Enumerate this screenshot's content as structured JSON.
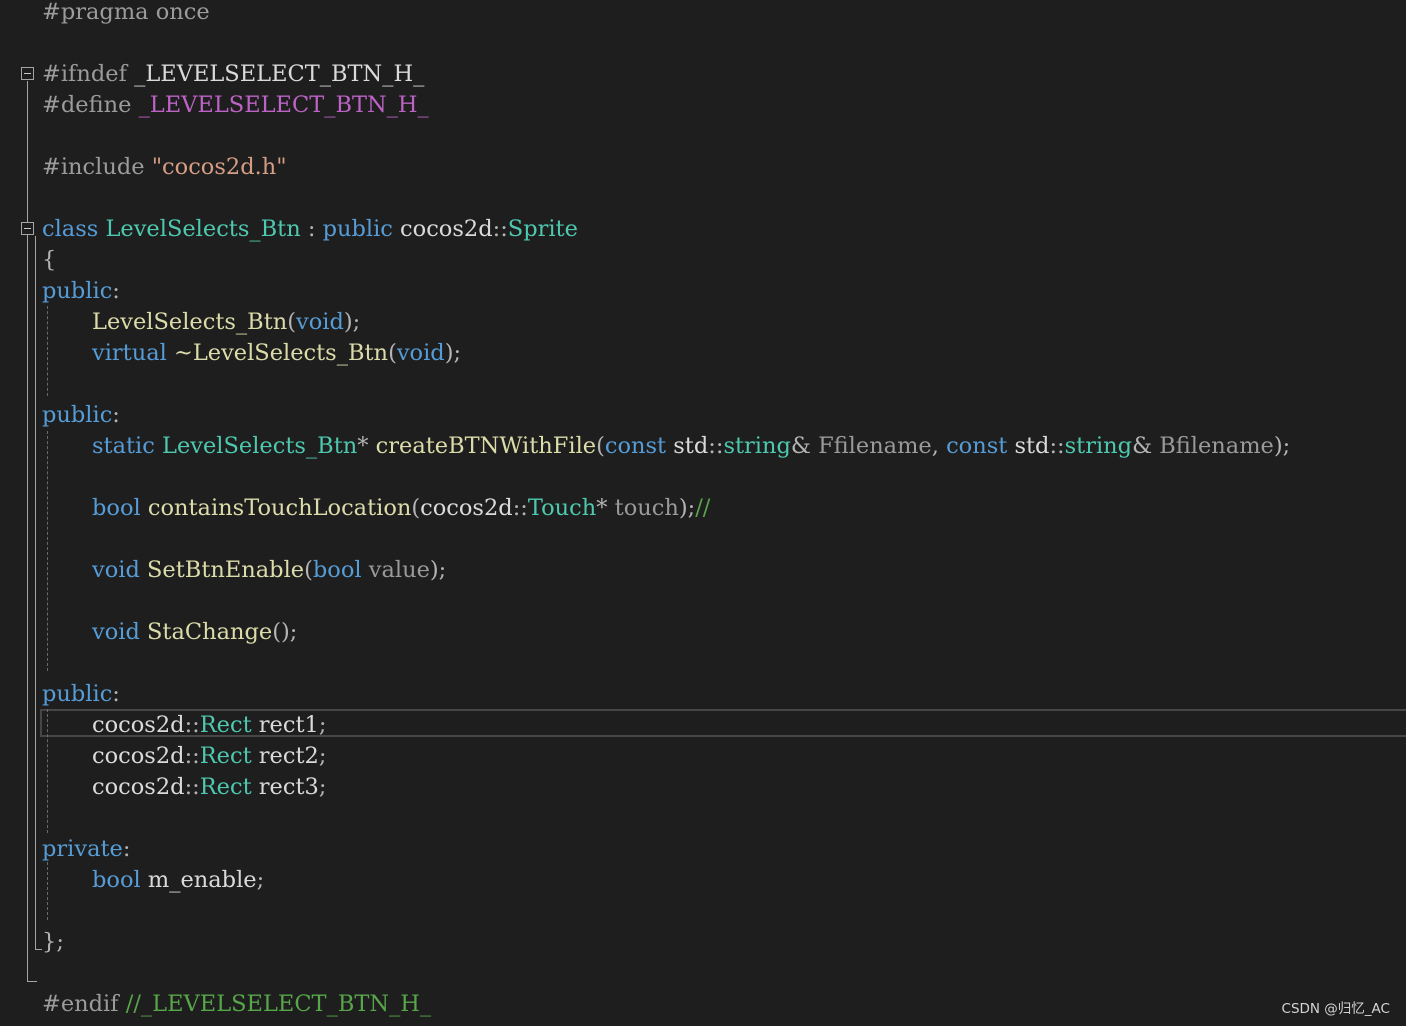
{
  "editor": {
    "language": "cpp",
    "theme_colors": {
      "background": "#1e1e1e",
      "preprocessor": "#9b9b9b",
      "keyword": "#569cd6",
      "type": "#4ec9b0",
      "function": "#dcdcaa",
      "string": "#d69d85",
      "comment": "#57a64a",
      "punctuation": "#b4b4b4",
      "identifier": "#dadada",
      "parameter": "#9a9a9a",
      "macro": "#bd63c5"
    },
    "current_line": 23,
    "fold_markers": [
      "ifndef-region",
      "class-region"
    ],
    "lines": [
      {
        "n": 1,
        "tokens": [
          {
            "t": "#pragma once",
            "c": "pp"
          }
        ]
      },
      {
        "n": 3,
        "tokens": [
          {
            "t": "#ifndef ",
            "c": "pp"
          },
          {
            "t": "_LEVELSELECT_BTN_H_",
            "c": "id"
          }
        ]
      },
      {
        "n": 4,
        "tokens": [
          {
            "t": "#define ",
            "c": "pp"
          },
          {
            "t": "_LEVELSELECT_BTN_H_",
            "c": "mac"
          }
        ]
      },
      {
        "n": 6,
        "tokens": [
          {
            "t": "#include ",
            "c": "pp"
          },
          {
            "t": "\"cocos2d.h\"",
            "c": "str"
          }
        ]
      },
      {
        "n": 8,
        "tokens": [
          {
            "t": "class",
            "c": "kw"
          },
          {
            "t": " ",
            "c": "id"
          },
          {
            "t": "LevelSelects_Btn",
            "c": "type"
          },
          {
            "t": " : ",
            "c": "pu"
          },
          {
            "t": "public",
            "c": "kw"
          },
          {
            "t": " cocos2d",
            "c": "id"
          },
          {
            "t": "::",
            "c": "pu"
          },
          {
            "t": "Sprite",
            "c": "type"
          }
        ]
      },
      {
        "n": 9,
        "tokens": [
          {
            "t": "{",
            "c": "pu"
          }
        ]
      },
      {
        "n": 10,
        "tokens": [
          {
            "t": "public",
            "c": "kw"
          },
          {
            "t": ":",
            "c": "pu"
          }
        ]
      },
      {
        "n": 11,
        "indent": true,
        "tokens": [
          {
            "t": "LevelSelects_Btn",
            "c": "fn"
          },
          {
            "t": "(",
            "c": "pu"
          },
          {
            "t": "void",
            "c": "kw"
          },
          {
            "t": ");",
            "c": "pu"
          }
        ]
      },
      {
        "n": 12,
        "indent": true,
        "tokens": [
          {
            "t": "virtual",
            "c": "kw"
          },
          {
            "t": " ",
            "c": "id"
          },
          {
            "t": "~LevelSelects_Btn",
            "c": "fn"
          },
          {
            "t": "(",
            "c": "pu"
          },
          {
            "t": "void",
            "c": "kw"
          },
          {
            "t": ");",
            "c": "pu"
          }
        ]
      },
      {
        "n": 14,
        "tokens": [
          {
            "t": "public",
            "c": "kw"
          },
          {
            "t": ":",
            "c": "pu"
          }
        ]
      },
      {
        "n": 15,
        "indent": true,
        "tokens": [
          {
            "t": "static",
            "c": "kw"
          },
          {
            "t": " ",
            "c": "id"
          },
          {
            "t": "LevelSelects_Btn",
            "c": "type"
          },
          {
            "t": "* ",
            "c": "pu"
          },
          {
            "t": "createBTNWithFile",
            "c": "fn"
          },
          {
            "t": "(",
            "c": "pu"
          },
          {
            "t": "const",
            "c": "kw"
          },
          {
            "t": " std",
            "c": "id"
          },
          {
            "t": "::",
            "c": "pu"
          },
          {
            "t": "string",
            "c": "type"
          },
          {
            "t": "& ",
            "c": "pu"
          },
          {
            "t": "Ffilename",
            "c": "par"
          },
          {
            "t": ", ",
            "c": "pu"
          },
          {
            "t": "const",
            "c": "kw"
          },
          {
            "t": " std",
            "c": "id"
          },
          {
            "t": "::",
            "c": "pu"
          },
          {
            "t": "string",
            "c": "type"
          },
          {
            "t": "& ",
            "c": "pu"
          },
          {
            "t": "Bfilename",
            "c": "par"
          },
          {
            "t": ");",
            "c": "pu"
          }
        ]
      },
      {
        "n": 17,
        "indent": true,
        "tokens": [
          {
            "t": "bool",
            "c": "kw"
          },
          {
            "t": " ",
            "c": "id"
          },
          {
            "t": "containsTouchLocation",
            "c": "fn"
          },
          {
            "t": "(",
            "c": "pu"
          },
          {
            "t": "cocos2d",
            "c": "id"
          },
          {
            "t": "::",
            "c": "pu"
          },
          {
            "t": "Touch",
            "c": "type"
          },
          {
            "t": "* ",
            "c": "pu"
          },
          {
            "t": "touch",
            "c": "par"
          },
          {
            "t": ");",
            "c": "pu"
          },
          {
            "t": "//",
            "c": "cm"
          }
        ]
      },
      {
        "n": 19,
        "indent": true,
        "tokens": [
          {
            "t": "void",
            "c": "kw"
          },
          {
            "t": " ",
            "c": "id"
          },
          {
            "t": "SetBtnEnable",
            "c": "fn"
          },
          {
            "t": "(",
            "c": "pu"
          },
          {
            "t": "bool",
            "c": "kw"
          },
          {
            "t": " ",
            "c": "id"
          },
          {
            "t": "value",
            "c": "par"
          },
          {
            "t": ");",
            "c": "pu"
          }
        ]
      },
      {
        "n": 21,
        "indent": true,
        "tokens": [
          {
            "t": "void",
            "c": "kw"
          },
          {
            "t": " ",
            "c": "id"
          },
          {
            "t": "StaChange",
            "c": "fn"
          },
          {
            "t": "();",
            "c": "pu"
          }
        ]
      },
      {
        "n": 23,
        "tokens": [
          {
            "t": "public",
            "c": "kw"
          },
          {
            "t": ":",
            "c": "pu"
          }
        ]
      },
      {
        "n": 24,
        "indent": true,
        "tokens": [
          {
            "t": "cocos2d",
            "c": "id"
          },
          {
            "t": "::",
            "c": "pu"
          },
          {
            "t": "Rect",
            "c": "type"
          },
          {
            "t": " rect1",
            "c": "id"
          },
          {
            "t": ";",
            "c": "pu"
          }
        ]
      },
      {
        "n": 25,
        "indent": true,
        "tokens": [
          {
            "t": "cocos2d",
            "c": "id"
          },
          {
            "t": "::",
            "c": "pu"
          },
          {
            "t": "Rect",
            "c": "type"
          },
          {
            "t": " rect2",
            "c": "id"
          },
          {
            "t": ";",
            "c": "pu"
          }
        ]
      },
      {
        "n": 26,
        "indent": true,
        "tokens": [
          {
            "t": "cocos2d",
            "c": "id"
          },
          {
            "t": "::",
            "c": "pu"
          },
          {
            "t": "Rect",
            "c": "type"
          },
          {
            "t": " rect3",
            "c": "id"
          },
          {
            "t": ";",
            "c": "pu"
          }
        ]
      },
      {
        "n": 28,
        "tokens": [
          {
            "t": "private",
            "c": "kw"
          },
          {
            "t": ":",
            "c": "pu"
          }
        ]
      },
      {
        "n": 29,
        "indent": true,
        "tokens": [
          {
            "t": "bool",
            "c": "kw"
          },
          {
            "t": " m_enable",
            "c": "id"
          },
          {
            "t": ";",
            "c": "pu"
          }
        ]
      },
      {
        "n": 31,
        "tokens": [
          {
            "t": "};",
            "c": "pu"
          }
        ]
      },
      {
        "n": 33,
        "tokens": [
          {
            "t": "#endif ",
            "c": "pp"
          },
          {
            "t": "//_LEVELSELECT_BTN_H_",
            "c": "cm"
          }
        ]
      }
    ]
  },
  "watermark": "CSDN @归忆_AC"
}
